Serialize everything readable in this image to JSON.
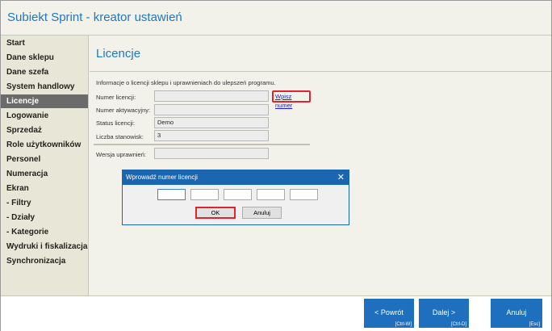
{
  "window": {
    "title": "Subiekt Sprint - kreator ustawień"
  },
  "sidebar": {
    "items": [
      {
        "label": "Start"
      },
      {
        "label": "Dane sklepu"
      },
      {
        "label": "Dane szefa"
      },
      {
        "label": "System handlowy"
      },
      {
        "label": "Licencje",
        "selected": true
      },
      {
        "label": "Logowanie"
      },
      {
        "label": "Sprzedaż"
      },
      {
        "label": "Role użytkowników"
      },
      {
        "label": "Personel"
      },
      {
        "label": "Numeracja"
      },
      {
        "label": "Ekran"
      },
      {
        "label": "- Filtry"
      },
      {
        "label": "- Działy"
      },
      {
        "label": "- Kategorie"
      },
      {
        "label": "Wydruki i fiskalizacja"
      },
      {
        "label": "Synchronizacja"
      }
    ]
  },
  "page": {
    "title": "Licencje",
    "info": "Informacje o licencji sklepu i uprawnieniach do ulepszeń programu.",
    "fields": {
      "license_number": {
        "label": "Numer licencji:",
        "value": ""
      },
      "activation_number": {
        "label": "Numer aktywacyjny:",
        "value": ""
      },
      "status": {
        "label": "Status licencji:",
        "value": "Demo"
      },
      "stations": {
        "label": "Liczba stanowisk:",
        "value": "3"
      },
      "version": {
        "label": "Wersja uprawnień:",
        "value": ""
      }
    },
    "enter_number_link": "Wpisz numer"
  },
  "dialog": {
    "title": "Wprowadź numer licencji",
    "close": "✕",
    "ok": "OK",
    "cancel": "Anuluj"
  },
  "footer": {
    "back": {
      "label": "< Powrót",
      "shortcut": "[Ctrl-W]"
    },
    "next": {
      "label": "Dalej >",
      "shortcut": "[Ctrl-D]"
    },
    "cancel": {
      "label": "Anuluj",
      "shortcut": "[Esc]"
    }
  }
}
